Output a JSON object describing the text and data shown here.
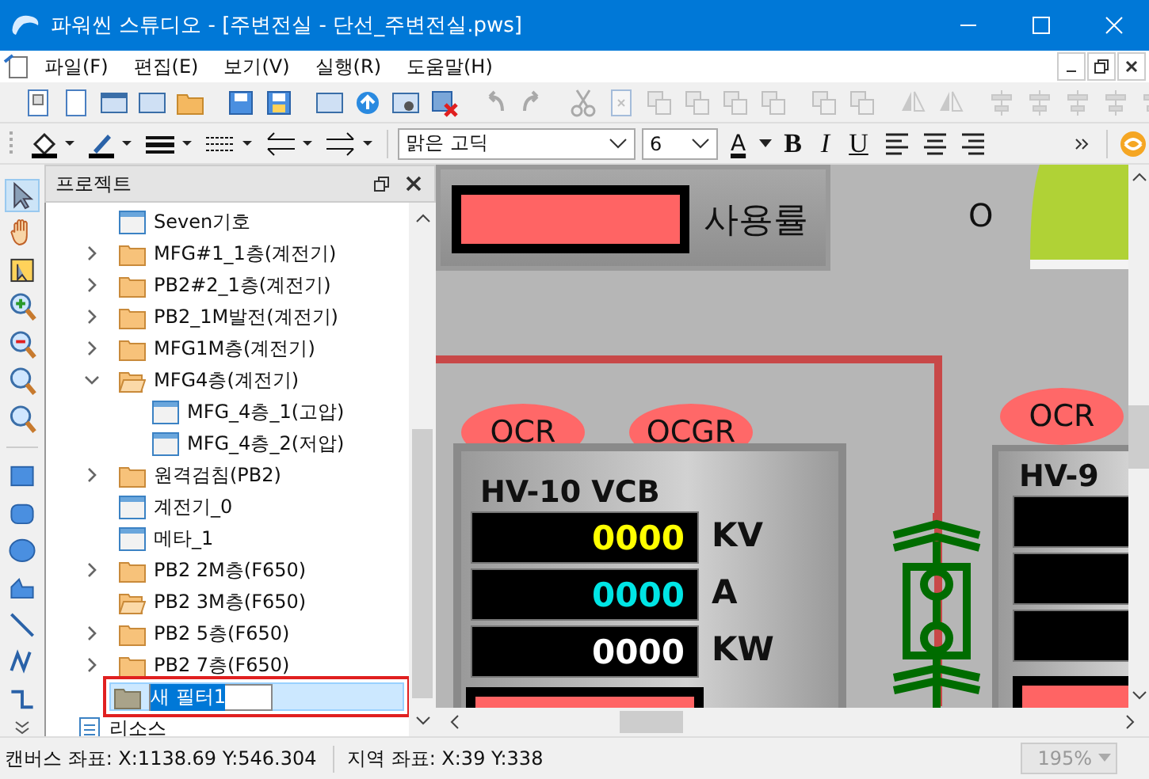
{
  "window": {
    "title": "파워씬 스튜디오 - [주변전실 - 단선_주변전실.pws]"
  },
  "menu": [
    {
      "label": "파일(F)"
    },
    {
      "label": "편집(E)"
    },
    {
      "label": "보기(V)"
    },
    {
      "label": "실행(R)"
    },
    {
      "label": "도움말(H)"
    }
  ],
  "format_bar": {
    "font": "맑은 고딕",
    "size": "6",
    "text_color_letter": "A",
    "bold": "B",
    "italic": "I",
    "underline": "U"
  },
  "project_panel": {
    "title": "프로젝트",
    "items": [
      {
        "kind": "page",
        "label": "Seven기호"
      },
      {
        "kind": "folder",
        "label": "MFG#1_1층(계전기)",
        "expandable": true,
        "expanded": false
      },
      {
        "kind": "folder",
        "label": "PB2#2_1층(계전기)",
        "expandable": true,
        "expanded": false
      },
      {
        "kind": "folder",
        "label": "PB2_1M발전(계전기)",
        "expandable": true,
        "expanded": false
      },
      {
        "kind": "folder",
        "label": "MFG1M층(계전기)",
        "expandable": true,
        "expanded": false
      },
      {
        "kind": "folder",
        "label": "MFG4층(계전기)",
        "expandable": true,
        "expanded": true,
        "children": [
          {
            "kind": "page",
            "label": "MFG_4층_1(고압)"
          },
          {
            "kind": "page",
            "label": "MFG_4층_2(저압)"
          }
        ]
      },
      {
        "kind": "folder",
        "label": "원격검침(PB2)",
        "expandable": true,
        "expanded": false
      },
      {
        "kind": "page",
        "label": "계전기_0"
      },
      {
        "kind": "page",
        "label": "메타_1"
      },
      {
        "kind": "folder",
        "label": "PB2 2M층(F650)",
        "expandable": true,
        "expanded": false
      },
      {
        "kind": "folder",
        "label": "PB2 3M층(F650)",
        "expandable": false,
        "expanded": true
      },
      {
        "kind": "folder",
        "label": "PB2 5층(F650)",
        "expandable": true,
        "expanded": false
      },
      {
        "kind": "folder",
        "label": "PB2 7층(F650)",
        "expandable": true,
        "expanded": false
      },
      {
        "kind": "new-folder",
        "value": "새 필터1",
        "selected": true,
        "highlighted": true
      }
    ],
    "root_after": {
      "kind": "resource",
      "label": "리소스"
    }
  },
  "canvas": {
    "usage_label": "사용률",
    "state_mark": "O",
    "relay_tags": [
      {
        "label": "OCR"
      },
      {
        "label": "OCGR"
      }
    ],
    "panel": {
      "title": "HV-10 VCB",
      "readouts": [
        {
          "value": "0000",
          "unit": "KV",
          "color": "#ffff00"
        },
        {
          "value": "0000",
          "unit": "A",
          "color": "#00e5e5"
        },
        {
          "value": "0000",
          "unit": "KW",
          "color": "#ffffff"
        }
      ]
    },
    "right_tag": "OCR",
    "right_panel_title": "HV-9"
  },
  "status_bar": {
    "canvas_coords": "캔버스 좌표: X:1138.69 Y:546.304",
    "local_coords": "지역 좌표: X:39 Y:338",
    "zoom": "195%",
    "zoom_disabled": true
  }
}
